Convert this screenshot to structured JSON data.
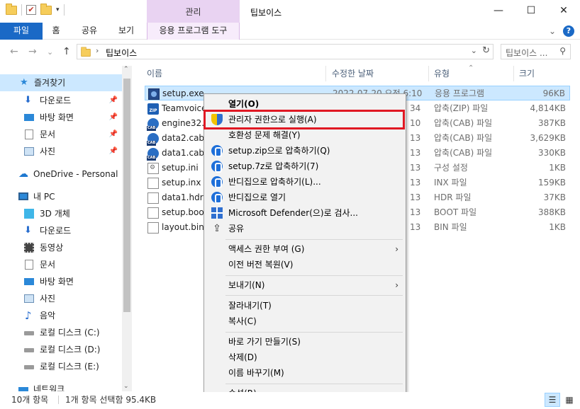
{
  "titlebar": {
    "context_tab_head": "관리",
    "window_title": "팁보이스",
    "minimize": "—",
    "maximize": "☐",
    "close": "✕"
  },
  "ribbon": {
    "tabs": [
      "파일",
      "홈",
      "공유",
      "보기",
      "응용 프로그램 도구"
    ],
    "collapse": "⌄",
    "help": "?"
  },
  "address": {
    "back": "←",
    "forward": "→",
    "recent": "⌄",
    "up": "↑",
    "chevron": "›",
    "path": "팁보이스",
    "dropdown": "⌄",
    "refresh": "↻",
    "search_placeholder": "팁보이스 ...",
    "search_icon": "⚲"
  },
  "nav": {
    "items": [
      {
        "label": "즐겨찾기",
        "icon": "star-icon"
      },
      {
        "label": "다운로드",
        "icon": "download-icon"
      },
      {
        "label": "바탕 화면",
        "icon": "desktop-icon"
      },
      {
        "label": "문서",
        "icon": "document-icon"
      },
      {
        "label": "사진",
        "icon": "pictures-icon"
      },
      {
        "label": "OneDrive - Personal",
        "icon": "cloud-icon"
      },
      {
        "label": "내 PC",
        "icon": "pc-icon"
      },
      {
        "label": "3D 개체",
        "icon": "cube-icon"
      },
      {
        "label": "다운로드",
        "icon": "download-icon"
      },
      {
        "label": "동영상",
        "icon": "video-icon"
      },
      {
        "label": "문서",
        "icon": "document-icon"
      },
      {
        "label": "바탕 화면",
        "icon": "desktop-icon"
      },
      {
        "label": "사진",
        "icon": "pictures-icon"
      },
      {
        "label": "음악",
        "icon": "music-icon"
      },
      {
        "label": "로컬 디스크 (C:)",
        "icon": "drive-icon"
      },
      {
        "label": "로컬 디스크 (D:)",
        "icon": "drive-icon"
      },
      {
        "label": "로컬 디스크 (E:)",
        "icon": "drive-icon"
      },
      {
        "label": "네트워크",
        "icon": "network-icon"
      }
    ],
    "pin": "📌"
  },
  "columns": {
    "name": "이름",
    "date": "수정한 날짜",
    "type": "유형",
    "size": "크기",
    "sort_indicator": "⌃"
  },
  "files": [
    {
      "name": "setup.exe",
      "date": "2022-07-20 오전 6:10",
      "type": "응용 프로그램",
      "size": "96KB",
      "icon": "exe"
    },
    {
      "name": "Teamvoice",
      "date": "34",
      "type": "압축(ZIP) 파일",
      "size": "4,814KB",
      "icon": "zip"
    },
    {
      "name": "engine32.c",
      "date": "10",
      "type": "압축(CAB) 파일",
      "size": "387KB",
      "icon": "cab"
    },
    {
      "name": "data2.cab",
      "date": "13",
      "type": "압축(CAB) 파일",
      "size": "3,629KB",
      "icon": "cab"
    },
    {
      "name": "data1.cab",
      "date": "13",
      "type": "압축(CAB) 파일",
      "size": "330KB",
      "icon": "cab"
    },
    {
      "name": "setup.ini",
      "date": "13",
      "type": "구성 설정",
      "size": "1KB",
      "icon": "ini"
    },
    {
      "name": "setup.inx",
      "date": "13",
      "type": "INX 파일",
      "size": "159KB",
      "icon": "doc"
    },
    {
      "name": "data1.hdr",
      "date": "13",
      "type": "HDR 파일",
      "size": "37KB",
      "icon": "doc"
    },
    {
      "name": "setup.boot",
      "date": "13",
      "type": "BOOT 파일",
      "size": "388KB",
      "icon": "doc"
    },
    {
      "name": "layout.bin",
      "date": "13",
      "type": "BIN 파일",
      "size": "1KB",
      "icon": "doc"
    }
  ],
  "context_menu": {
    "items": [
      {
        "label": "열기(O)",
        "bold": true
      },
      {
        "label": "관리자 권한으로 실행(A)",
        "icon": "shield"
      },
      {
        "label": "호환성 문제 해결(Y)"
      },
      {
        "label": "setup.zip으로 압축하기(Q)",
        "icon": "bandizip"
      },
      {
        "label": "setup.7z로 압축하기(7)",
        "icon": "bandizip"
      },
      {
        "label": "반디집으로 압축하기(L)...",
        "icon": "bandizip"
      },
      {
        "label": "반디집으로 열기",
        "icon": "bandizip"
      },
      {
        "label": "Microsoft Defender(으)로 검사...",
        "icon": "defender"
      },
      {
        "label": "공유",
        "icon": "share"
      },
      {
        "label": "액세스 권한 부여 (G)",
        "submenu": true
      },
      {
        "label": "이전 버전 복원(V)"
      },
      {
        "label": "보내기(N)",
        "submenu": true
      },
      {
        "label": "잘라내기(T)"
      },
      {
        "label": "복사(C)"
      },
      {
        "label": "바로 가기 만들기(S)"
      },
      {
        "label": "삭제(D)"
      },
      {
        "label": "이름 바꾸기(M)"
      },
      {
        "label": "속성(R)"
      }
    ],
    "submenu_arrow": "›"
  },
  "status": {
    "count": "10개 항목",
    "selection": "1개 항목 선택함 95.4KB"
  },
  "scrollbar": {
    "up": "⌃",
    "down": "⌄"
  },
  "colors": {
    "accent": "#1a69c6",
    "selection": "#cce8ff",
    "highlight_box": "#e01823",
    "context_tab": "#e9d3f2"
  }
}
